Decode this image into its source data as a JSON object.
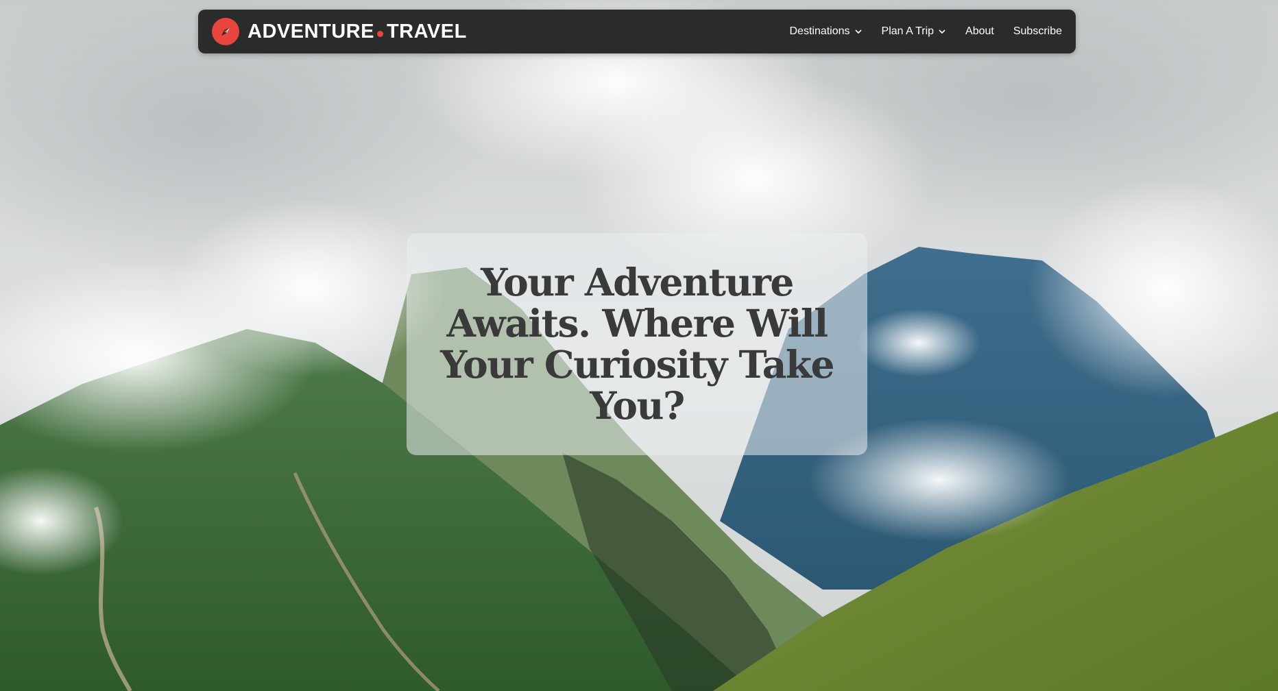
{
  "brand": {
    "name_part1": "ADVENTURE",
    "name_part2": "TRAVEL",
    "logo_icon": "compass-icon",
    "accent_color": "#e8453c"
  },
  "nav": {
    "items": [
      {
        "label": "Destinations",
        "has_dropdown": true
      },
      {
        "label": "Plan A Trip",
        "has_dropdown": true
      },
      {
        "label": "About",
        "has_dropdown": false
      },
      {
        "label": "Subscribe",
        "has_dropdown": false
      }
    ]
  },
  "hero": {
    "headline": "Your Adventure Awaits. Where Will Your Curiosity Take You?",
    "background": "misty-mountain-landscape"
  },
  "colors": {
    "navbar_bg": "#2b2b2b",
    "headline_text": "#3a3a3a"
  }
}
